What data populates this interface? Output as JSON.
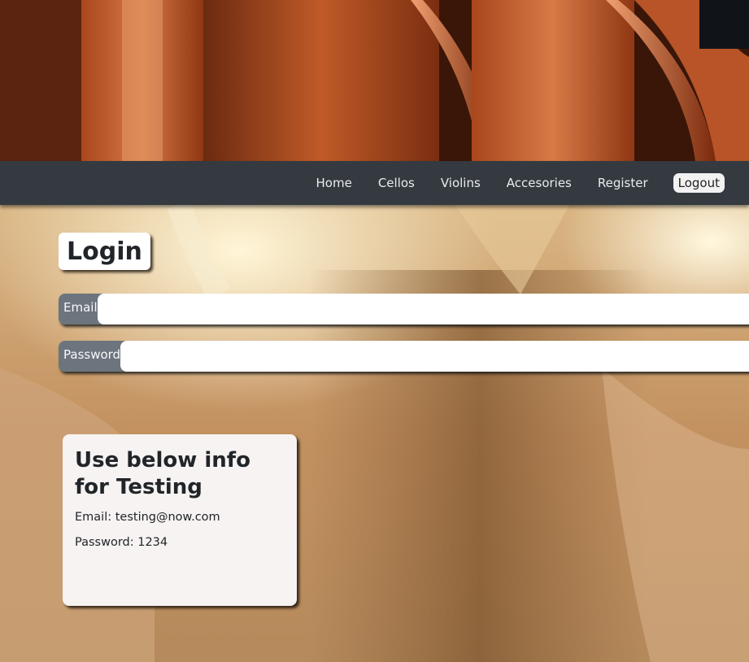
{
  "nav": {
    "items": [
      {
        "label": "Home"
      },
      {
        "label": "Cellos"
      },
      {
        "label": "Violins"
      },
      {
        "label": "Accesories"
      },
      {
        "label": "Register"
      }
    ],
    "logout_label": "Logout"
  },
  "login": {
    "title": "Login",
    "email_label": "Email",
    "email_value": "",
    "password_label": "Password",
    "password_value": ""
  },
  "info": {
    "title": "Use below info for Testing",
    "email_line": "Email: testing@now.com",
    "password_line": "Password: 1234"
  },
  "colors": {
    "navbar": "#343a40",
    "input_label": "#6c757d",
    "card": "#f6f3f2"
  }
}
